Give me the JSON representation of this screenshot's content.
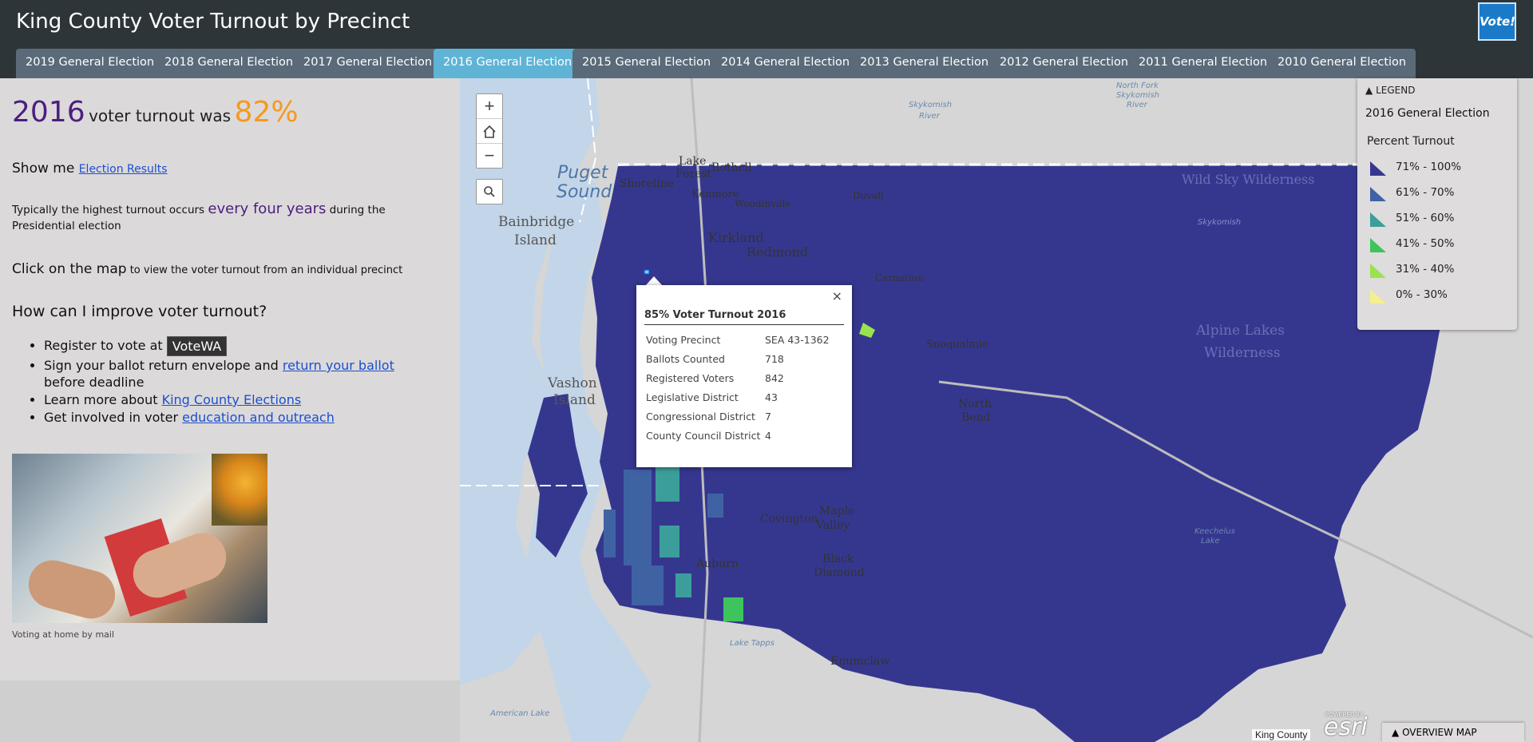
{
  "header": {
    "title": "King County Voter Turnout by Precinct",
    "logo_text": "Vote!"
  },
  "tabs": [
    {
      "label": "2019 General Election",
      "active": false
    },
    {
      "label": "2018 General Election",
      "active": false
    },
    {
      "label": "2017 General Election",
      "active": false
    },
    {
      "label": "2016 General Election",
      "active": true
    },
    {
      "label": "2015 General Election",
      "active": false
    },
    {
      "label": "2014 General Election",
      "active": false
    },
    {
      "label": "2013 General Election",
      "active": false
    },
    {
      "label": "2012 General Election",
      "active": false
    },
    {
      "label": "2011 General Election",
      "active": false
    },
    {
      "label": "2010 General Election",
      "active": false
    }
  ],
  "panel": {
    "year": "2016",
    "turnout_label": "voter turnout was",
    "percent": "82%",
    "show_me_prefix": "Show me ",
    "show_me_link": "Election Results",
    "typical_prefix": "Typically the highest turnout occurs ",
    "typical_emph": "every four years",
    "typical_suffix": " during the Presidential election",
    "click_bold": "Click on the map",
    "click_rest": " to view the voter turnout from an individual precinct",
    "how_heading": "How can I improve voter turnout?",
    "tip1_prefix": "Register to vote at ",
    "tip1_logo": "VoteWA",
    "tip2_prefix": "Sign your ballot return envelope and ",
    "tip2_link": "return your ballot",
    "tip2_suffix": " before deadline",
    "tip3_prefix": "Learn more about ",
    "tip3_link": "King County Elections",
    "tip4_prefix": "Get involved in voter ",
    "tip4_link": "education and outreach",
    "photo_caption": "Voting at home by mail"
  },
  "map": {
    "labels": {
      "puget": "Puget",
      "sound": "Sound",
      "bainbridge": "Bainbridge",
      "island": "Island",
      "vashon": "Vashon",
      "vashon_island": "Island",
      "lake_forest": "Lake",
      "forest_park": "Forest",
      "bothell": "Bothell",
      "shoreline": "Shoreline",
      "kenmore": "Kenmore",
      "woodinville": "Woodinville",
      "duvall": "Duvall",
      "kirkland": "Kirkland",
      "redmond": "Redmond",
      "carnation": "Carnation",
      "snoqualmie": "Snoqualmie",
      "north_bend": "North",
      "north_bend2": "Bend",
      "maple_valley": "Maple",
      "maple_valley2": "Valley",
      "covington": "Covington",
      "black_diamond": "Black",
      "black_diamond2": "Diamond",
      "auburn": "Auburn",
      "enumclaw": "Enumclaw",
      "alpine": "Alpine Lakes",
      "wilderness": "Wilderness",
      "wild_sky": "Wild Sky Wilderness",
      "skykomish_river": "Skykomish",
      "skykomish_river2": "River",
      "north_fork": "North Fork",
      "north_fork2": "Skykomish",
      "north_fork3": "River",
      "skykomish": "Skykomish",
      "lake_tapps": "Lake Tapps",
      "keechelus": "Keechelus",
      "keechelus2": "Lake",
      "american_lake": "American Lake"
    },
    "popup": {
      "title": "85% Voter Turnout 2016",
      "close_glyph": "×",
      "rows": [
        {
          "key": "Voting Precinct",
          "value": "SEA 43-1362"
        },
        {
          "key": "Ballots Counted",
          "value": "718"
        },
        {
          "key": "Registered Voters",
          "value": "842"
        },
        {
          "key": "Legislative District",
          "value": "43"
        },
        {
          "key": "Congressional District",
          "value": "7"
        },
        {
          "key": "County Council District",
          "value": "4"
        }
      ]
    },
    "zoom_in": "+",
    "home_icon": "home-icon",
    "zoom_out": "−",
    "search_icon": "search-icon"
  },
  "legend": {
    "header": "LEGEND",
    "subtitle": "2016 General Election",
    "field": "Percent Turnout",
    "items": [
      {
        "label": "71% - 100%",
        "color": "#35378f"
      },
      {
        "label": "61% - 70%",
        "color": "#3f62a3"
      },
      {
        "label": "51% - 60%",
        "color": "#3c9e9a"
      },
      {
        "label": "41% - 50%",
        "color": "#3ec45d"
      },
      {
        "label": "31% - 40%",
        "color": "#9be24f"
      },
      {
        "label": "0% - 30%",
        "color": "#f4ef8f"
      }
    ]
  },
  "footer": {
    "attribution": "King County",
    "esri_powered": "POWERED BY",
    "esri": "esri",
    "overview": "OVERVIEW MAP"
  }
}
